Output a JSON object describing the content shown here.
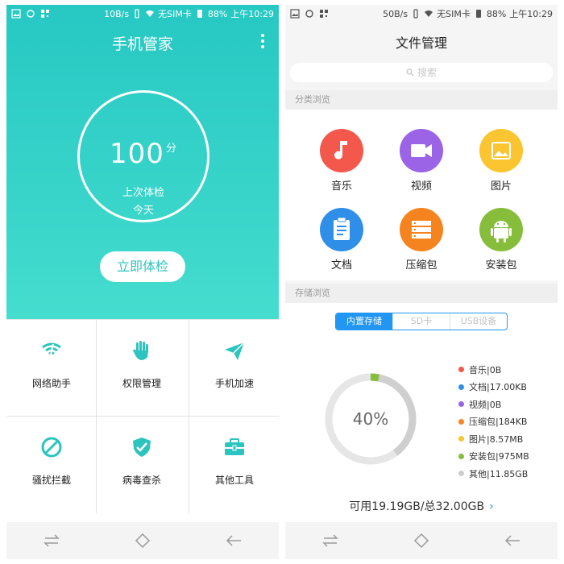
{
  "left": {
    "status": {
      "speed": "10B/s",
      "sim": "无SIM卡",
      "battery": "88%",
      "time": "上午10:29"
    },
    "title": "手机管家",
    "score": "100",
    "score_unit": "分",
    "last_check_label": "上次体检",
    "last_check_value": "今天",
    "check_button": "立即体检",
    "tools": [
      {
        "label": "网络助手",
        "icon": "wifi-icon"
      },
      {
        "label": "权限管理",
        "icon": "hand-icon"
      },
      {
        "label": "手机加速",
        "icon": "paper-plane-icon"
      },
      {
        "label": "骚扰拦截",
        "icon": "block-icon"
      },
      {
        "label": "病毒查杀",
        "icon": "shield-check-icon"
      },
      {
        "label": "其他工具",
        "icon": "toolbox-icon"
      }
    ],
    "accent": "#2cc4be"
  },
  "right": {
    "status": {
      "speed": "50B/s",
      "sim": "无SIM卡",
      "battery": "88%",
      "time": "上午10:29"
    },
    "title": "文件管理",
    "search_placeholder": "搜索",
    "category_header": "分类浏览",
    "categories": [
      {
        "label": "音乐",
        "color": "#f4584c",
        "icon": "music-note-icon"
      },
      {
        "label": "视频",
        "color": "#9b63e6",
        "icon": "video-camera-icon"
      },
      {
        "label": "图片",
        "color": "#fbc531",
        "icon": "image-icon"
      },
      {
        "label": "文档",
        "color": "#2f8fe8",
        "icon": "clipboard-icon"
      },
      {
        "label": "压缩包",
        "color": "#f5841f",
        "icon": "archive-icon"
      },
      {
        "label": "安装包",
        "color": "#86be3c",
        "icon": "android-icon"
      }
    ],
    "storage_header": "存储浏览",
    "storage_tabs": [
      "内置存储",
      "SD卡",
      "USB设备"
    ],
    "storage_tab_active": "内置存储",
    "used_percent": "40%",
    "legend": [
      {
        "label": "音乐|0B",
        "color": "#f4584c"
      },
      {
        "label": "文档|17.00KB",
        "color": "#2f8fe8"
      },
      {
        "label": "视频|0B",
        "color": "#9b63e6"
      },
      {
        "label": "压缩包|184KB",
        "color": "#f5841f"
      },
      {
        "label": "图片|8.57MB",
        "color": "#fbc531"
      },
      {
        "label": "安装包|975MB",
        "color": "#86be3c"
      },
      {
        "label": "其他|11.85GB",
        "color": "#cccccc"
      }
    ],
    "available_text": "可用19.19GB/总32.00GB",
    "chevron": "›"
  }
}
